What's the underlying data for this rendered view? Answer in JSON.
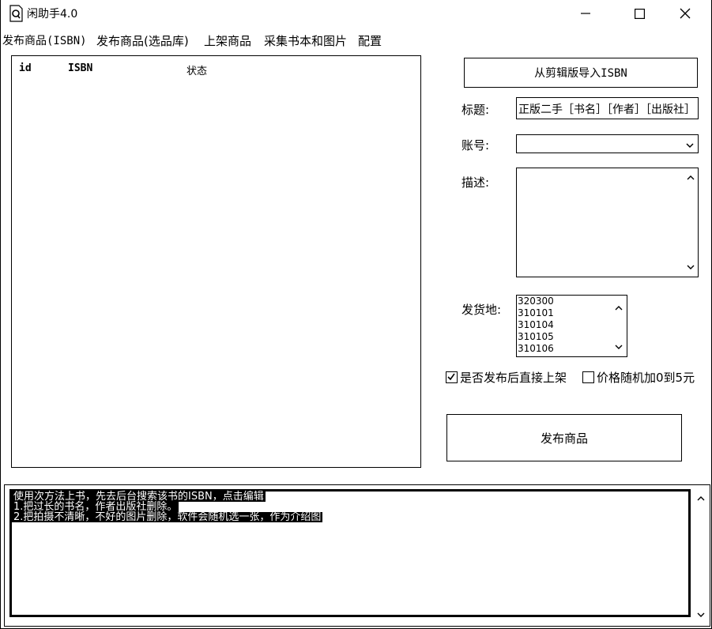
{
  "window": {
    "title": "闲助手4.0"
  },
  "menu": {
    "items": [
      "发布商品(ISBN)",
      "发布商品(选品库)",
      "上架商品",
      "采集书本和图片",
      "配置"
    ]
  },
  "list": {
    "columns": [
      "id",
      "ISBN",
      "状态"
    ]
  },
  "form": {
    "import_button": "从剪辑版导入ISBN",
    "title_label": "标题:",
    "title_value": "正版二手［书名］［作者］［出版社］",
    "account_label": "账号:",
    "account_value": "",
    "desc_label": "描述:",
    "desc_value": "",
    "ship_label": "发货地:",
    "ship_options": [
      "320300",
      "310101",
      "310104",
      "310105",
      "310106"
    ],
    "check_direct_label": "是否发布后直接上架",
    "check_direct_checked": true,
    "check_price_label": "价格随机加0到5元",
    "check_price_checked": false,
    "publish_button": "发布商品"
  },
  "log": {
    "lines": [
      "使用次方法上书，先去后台搜索该书的ISBN，点击编辑",
      "1.把过长的书名，作者出版社删除。",
      "2.把拍摄不清晰，不好的图片删除，软件会随机选一张，作为介绍图"
    ]
  },
  "icons": {
    "minimize": "minimize-icon",
    "maximize": "maximize-icon",
    "close": "close-icon",
    "app": "app-logo-icon",
    "dropdown": "chevron-down-icon",
    "scroll_up": "chevron-up-icon",
    "scroll_down": "chevron-down-icon",
    "check": "checkmark-icon"
  }
}
